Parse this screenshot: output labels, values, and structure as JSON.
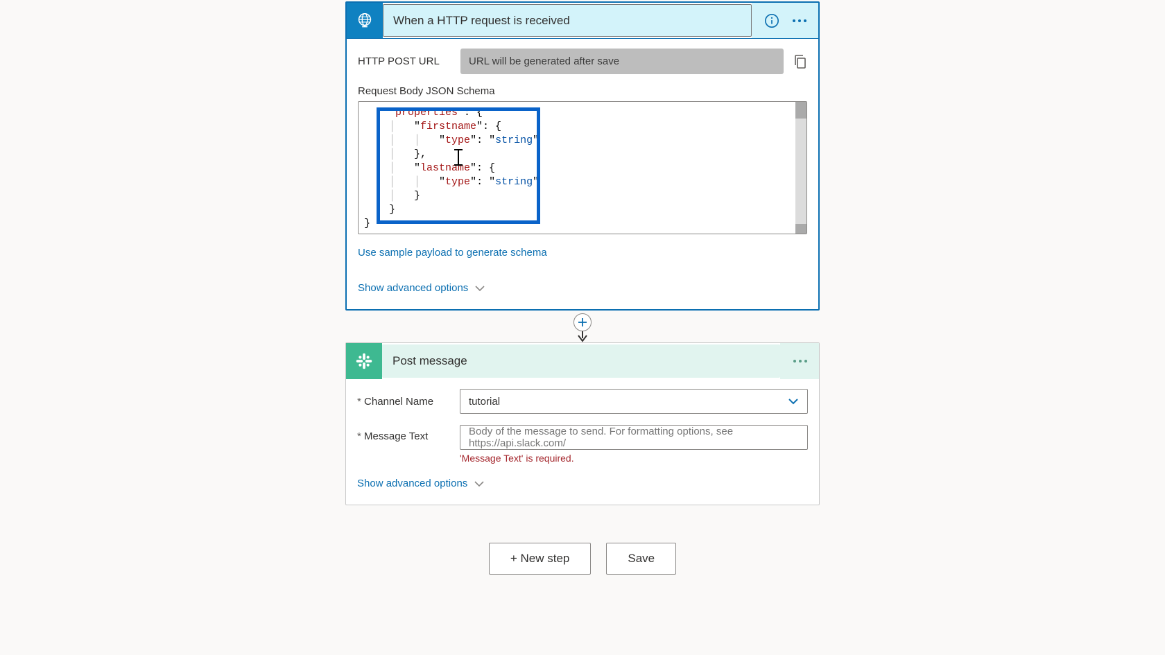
{
  "trigger": {
    "title": "When a HTTP request is received",
    "http_url_label": "HTTP POST URL",
    "http_url_value": "URL will be generated after save",
    "schema_label": "Request Body JSON Schema",
    "schema_tokens": {
      "properties": "properties",
      "firstname": "firstname",
      "lastname": "lastname",
      "type": "type",
      "string": "string"
    },
    "sample_link": "Use sample payload to generate schema",
    "advanced": "Show advanced options"
  },
  "action": {
    "title": "Post message",
    "channel_label": "Channel Name",
    "channel_value": "tutorial",
    "message_label": "Message Text",
    "message_placeholder": "Body of the message to send. For formatting options, see https://api.slack.com/",
    "message_error": "'Message Text' is required.",
    "advanced": "Show advanced options"
  },
  "footer": {
    "new_step": "+ New step",
    "save": "Save"
  }
}
